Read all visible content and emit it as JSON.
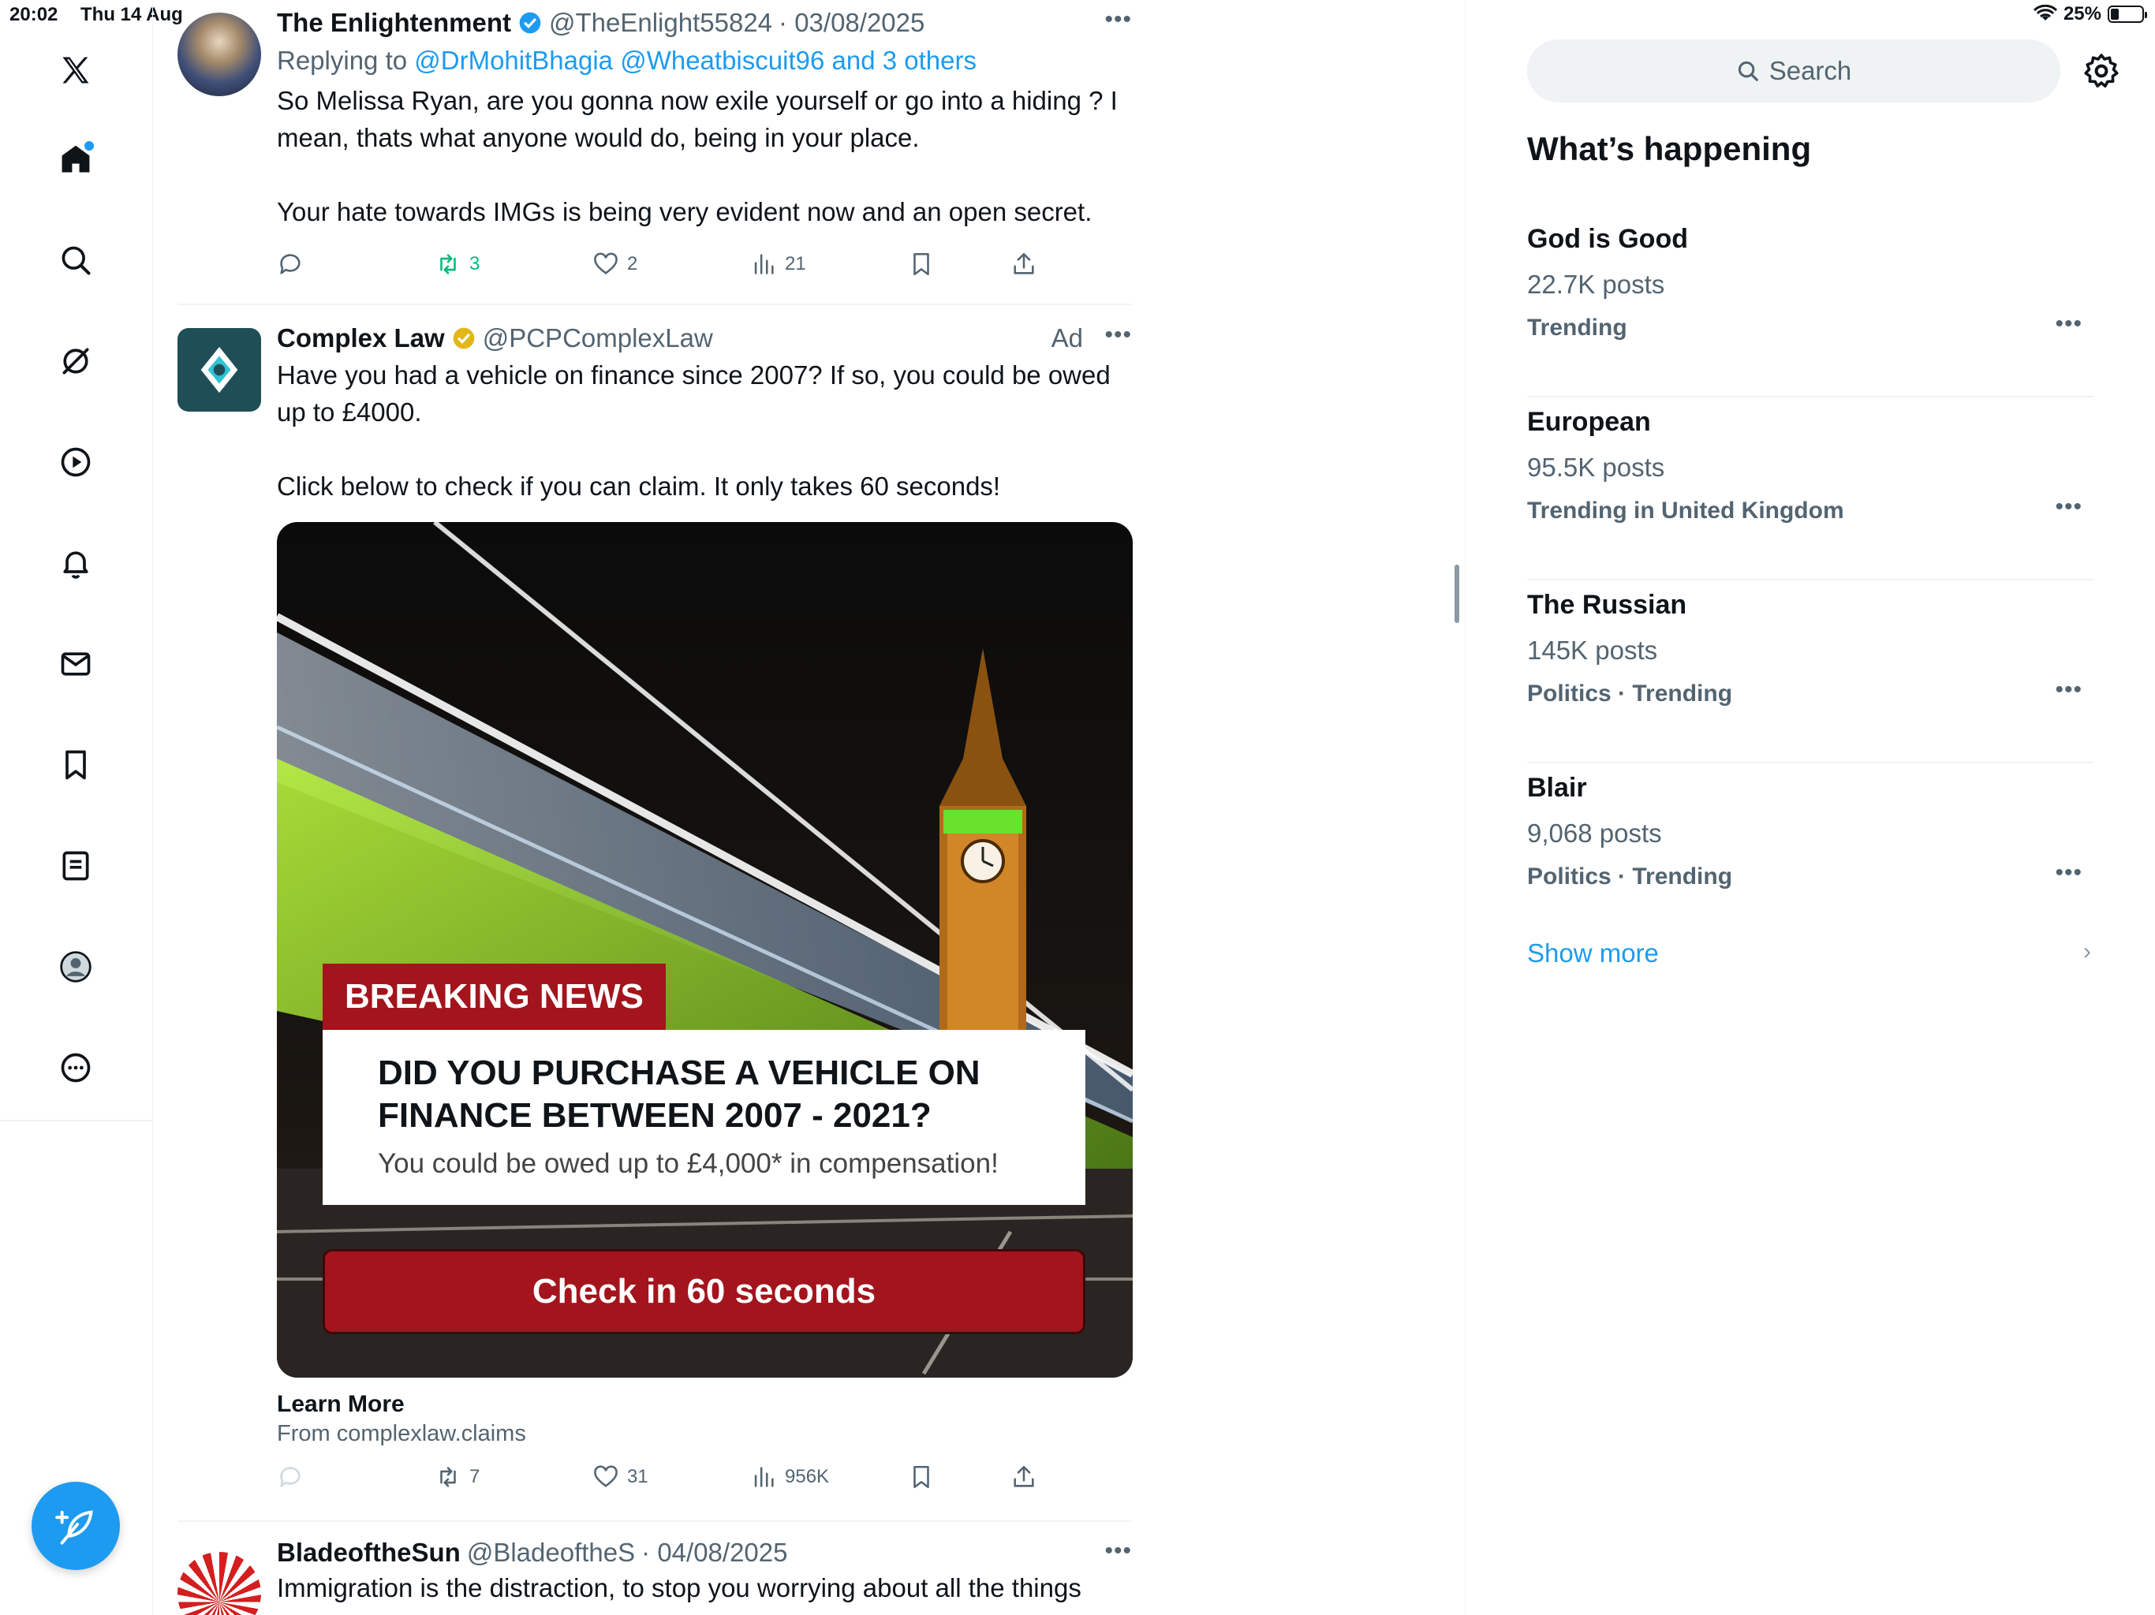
{
  "status_bar": {
    "time": "20:02",
    "date": "Thu 14 Aug",
    "battery": "25%",
    "battery_level": 0.25
  },
  "nav": {
    "items": [
      "home",
      "explore",
      "grok",
      "video",
      "notifications",
      "messages",
      "bookmarks",
      "lists",
      "profile",
      "more"
    ]
  },
  "tweets": [
    {
      "name": "The Enlightenment",
      "handle": "@TheEnlight55824",
      "date": "· 03/08/2025",
      "replying_prefix": "Replying to ",
      "replying_to": "@DrMohitBhagia @Wheatbiscuit96 and 3 others",
      "text": "So Melissa Ryan, are you gonna now exile yourself or go into a hiding ? I mean, thats what anyone would do, being in your place.\n\nYour hate towards IMGs is being very evident now and an open secret.",
      "retweets": "3",
      "likes": "2",
      "views": "21"
    },
    {
      "name": "Complex Law",
      "handle": "@PCPComplexLaw",
      "ad_label": "Ad",
      "text": "Have you had a vehicle on finance since 2007? If so, you could be owed up to £4000.\n\nClick below to check if you can claim. It only takes 60 seconds!",
      "image": {
        "banner": "BREAKING NEWS",
        "headline": "DID YOU PURCHASE A VEHICLE ON FINANCE BETWEEN 2007 - 2021?",
        "sub": "You could be owed up to £4,000* in compensation!",
        "cta": "Check in 60 seconds"
      },
      "card_title": "Learn More",
      "card_source": "From complexlaw.claims",
      "retweets": "7",
      "likes": "31",
      "views": "956K"
    },
    {
      "name": "BladeoftheSun",
      "handle": "@BladeoftheS",
      "date": "· 04/08/2025",
      "text": "Immigration is the distraction, to stop you worrying about all the things"
    }
  ],
  "sidebar": {
    "search_placeholder": "Search",
    "title": "What’s happening",
    "trends": [
      {
        "name": "God is Good",
        "count": "22.7K posts",
        "context": "Trending"
      },
      {
        "name": "European",
        "count": "95.5K posts",
        "context": "Trending in United Kingdom"
      },
      {
        "name": "The Russian",
        "count": "145K posts",
        "context": "Politics · Trending"
      },
      {
        "name": "Blair",
        "count": "9,068 posts",
        "context": "Politics · Trending"
      }
    ],
    "show_more": "Show more"
  },
  "colors": {
    "accent": "#1d9bf0",
    "retweet_green": "#00ba7c",
    "ad_red": "#a3141c",
    "text": "#0f1419",
    "muted": "#536471"
  }
}
